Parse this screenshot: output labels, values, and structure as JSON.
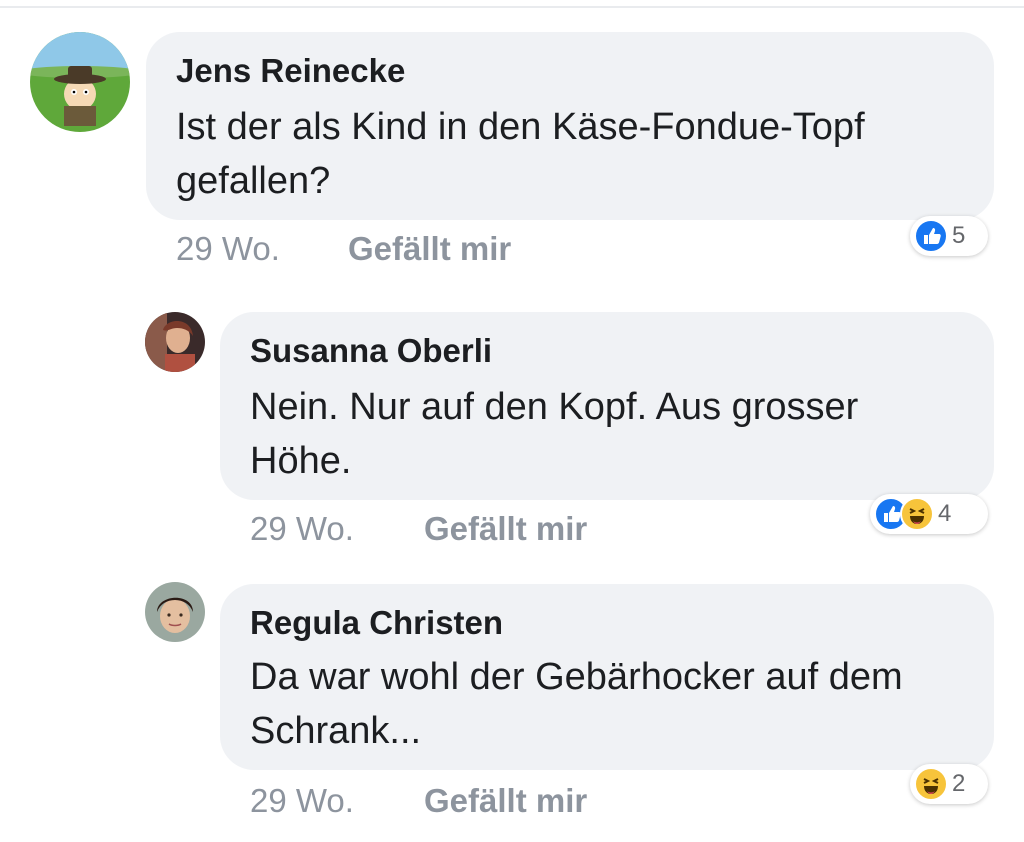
{
  "comments": [
    {
      "author": "Jens Reinecke",
      "text": "Ist der als Kind in den Käse-Fondue-Topf gefallen?",
      "time": "29 Wo.",
      "like_label": "Gefällt mir",
      "reactions": [
        "like-icon"
      ],
      "reaction_count": "5"
    },
    {
      "author": "Susanna Oberli",
      "text": "Nein.  Nur auf den Kopf. Aus grosser Höhe.",
      "time": "29 Wo.",
      "like_label": "Gefällt mir",
      "reactions": [
        "like-icon",
        "haha-icon"
      ],
      "reaction_count": "4"
    },
    {
      "author": "Regula Christen",
      "text": "Da war wohl der Gebärhocker auf dem Schrank...",
      "time": "29 Wo.",
      "like_label": "Gefällt mir",
      "reactions": [
        "haha-icon"
      ],
      "reaction_count": "2"
    }
  ],
  "colors": {
    "bubble": "#f0f2f5",
    "like_blue": "#1877f2",
    "haha_yellow": "#f7c43b",
    "meta_gray": "#8d949e"
  }
}
